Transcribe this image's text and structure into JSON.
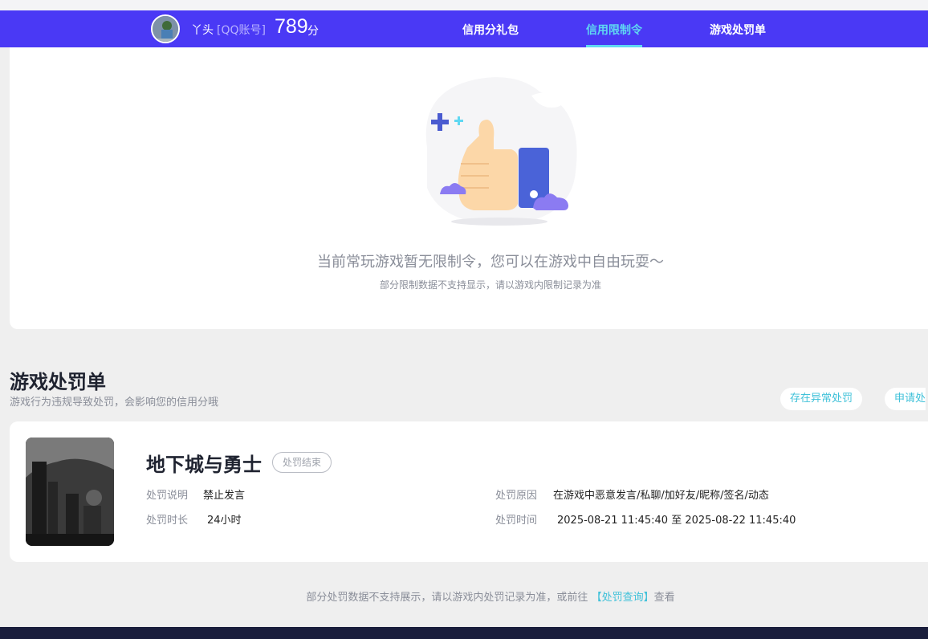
{
  "header": {
    "nickname": "丫头",
    "account_tag": "[QQ账号]",
    "score": "789",
    "score_unit": "分",
    "tabs": [
      {
        "label": "信用分礼包",
        "active": false
      },
      {
        "label": "信用限制令",
        "active": true
      },
      {
        "label": "游戏处罚单",
        "active": false
      }
    ],
    "accent_color": "#4a39f5",
    "active_color": "#5fd8f2"
  },
  "restriction": {
    "empty_title": "当前常玩游戏暂无限制令，您可以在游戏中自由玩耍～",
    "empty_subtitle": "部分限制数据不支持显示，请以游戏内限制记录为准",
    "illustration_icon": "thumbs-up-illustration"
  },
  "penalty": {
    "title": "游戏处罚单",
    "subtitle": "游戏行为违规导致处罚，会影响您的信用分哦",
    "buttons": [
      "存在异常处罚",
      "申请处"
    ],
    "records": [
      {
        "game": "地下城与勇士",
        "status": "处罚结束",
        "desc_label": "处罚说明",
        "desc_value": "禁止发言",
        "duration_label": "处罚时长",
        "duration_value": "24小时",
        "reason_label": "处罚原因",
        "reason_value": "在游戏中恶意发言/私聊/加好友/昵称/签名/动态",
        "time_label": "处罚时间",
        "time_value": "2025-08-21 11:45:40 至 2025-08-22 11:45:40"
      }
    ]
  },
  "footer": {
    "note_prefix": "部分处罚数据不支持展示，请以游戏内处罚记录为准，或前往",
    "link_text": "【处罚查询】",
    "note_suffix": "查看"
  }
}
